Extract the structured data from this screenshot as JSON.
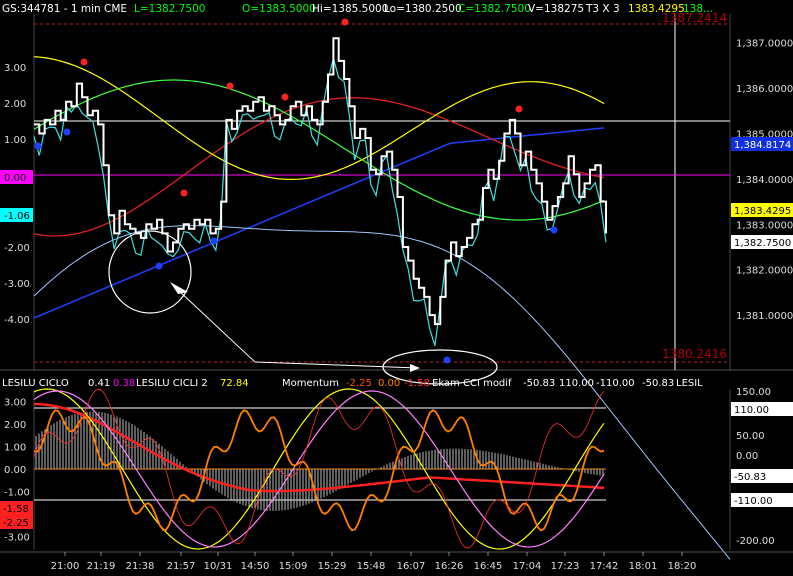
{
  "header": {
    "symbol": "GS:344781 - 1 min",
    "exchange": "CME",
    "last": "L=1382.7500",
    "open": "O=1383.5000",
    "high": "Hi=1385.5000",
    "low": "Lo=1380.2500",
    "close": "C=1382.7500",
    "volume": "V=138275",
    "timeframe": "T3 X 3",
    "val1": "1383.4295",
    "val2": "138..."
  },
  "price_panel": {
    "top_level_label": "1387.2414",
    "bottom_level_label": "1380.2416",
    "right_ticks": [
      "1,387.0000",
      "1,386.0000",
      "1,385.0000",
      "1,384.0000",
      "1,383.0000",
      "1,382.0000",
      "1,381.0000"
    ],
    "left_ticks": [
      "3.00",
      "2.00",
      "1.00",
      "0.00",
      "-1.00",
      "-2.00",
      "-3.00",
      "-4.00"
    ],
    "right_badges": [
      {
        "id": "blue",
        "text": "1,384.8174",
        "bg": "#1030e0",
        "fg": "#ffffff"
      },
      {
        "id": "yellow",
        "text": "1,383.4295",
        "bg": "#ffff00",
        "fg": "#000000"
      },
      {
        "id": "white",
        "text": "1,382.7500",
        "bg": "#ffffff",
        "fg": "#000000"
      }
    ],
    "left_badges": [
      {
        "id": "magenta",
        "text": "0.00",
        "bg": "#ff00ff",
        "fg": "#000000"
      },
      {
        "id": "cyan",
        "text": "-1.06",
        "bg": "#00ffff",
        "fg": "#000000"
      }
    ]
  },
  "osc_panel": {
    "legend": [
      {
        "text": "LESILU CICLO",
        "color": "#ffffff"
      },
      {
        "text": "0.41",
        "color": "#ffffff"
      },
      {
        "text": "0.38",
        "color": "#ff00ff"
      },
      {
        "text": "LESILU CICLI 2",
        "color": "#ffffff"
      },
      {
        "text": "72.84",
        "color": "#ffff00"
      },
      {
        "text": "Momentum",
        "color": "#ffffff"
      },
      {
        "text": "-2.25",
        "color": "#ff5000"
      },
      {
        "text": "0.00",
        "color": "#ff8000"
      },
      {
        "text": "-1.58",
        "color": "#ff3030"
      },
      {
        "text": "Ekam CCI modif",
        "color": "#ffffff"
      },
      {
        "text": "-50.83",
        "color": "#ffffff"
      },
      {
        "text": "110.00",
        "color": "#ffffff"
      },
      {
        "text": "-110.00",
        "color": "#ffffff"
      },
      {
        "text": "-50.83",
        "color": "#ffffff"
      },
      {
        "text": "LESIL",
        "color": "#ffffff"
      }
    ],
    "left_ticks": [
      "3.00",
      "2.00",
      "1.00",
      "0.00",
      "-1.00",
      "-2.00",
      "-3.00"
    ],
    "right_ticks": [
      "150.00",
      "50.00",
      "0.00",
      "-100.00",
      "-200.00"
    ],
    "right_badges": [
      {
        "id": "b110",
        "text": "110.00",
        "bg": "#ffffff",
        "fg": "#000000"
      },
      {
        "id": "b50",
        "text": "-50.83",
        "bg": "#ffffff",
        "fg": "#000000"
      },
      {
        "id": "bm110",
        "text": "-110.00",
        "bg": "#ffffff",
        "fg": "#000000"
      }
    ],
    "left_badges": [
      {
        "id": "r1",
        "text": "-1.58",
        "bg": "#ff2020",
        "fg": "#000000"
      },
      {
        "id": "r2",
        "text": "-2.25",
        "bg": "#ff2020",
        "fg": "#000000"
      }
    ]
  },
  "time_axis": [
    "21:00",
    "21:19",
    "21:38",
    "21:57",
    "10/31",
    "14:50",
    "15:09",
    "15:29",
    "15:48",
    "16:07",
    "16:26",
    "16:45",
    "17:04",
    "17:23",
    "17:42",
    "18:01",
    "18:20"
  ],
  "chart_data": {
    "type": "line",
    "price_range": [
      1379.9,
      1387.5
    ],
    "top_level": 1387.2414,
    "bottom_level": 1380.2416,
    "price": [
      1385.2,
      1385.0,
      1385.3,
      1385.2,
      1385.5,
      1385.3,
      1385.7,
      1385.6,
      1386.1,
      1385.8,
      1385.4,
      1385.5,
      1385.2,
      1384.3,
      1383.2,
      1382.8,
      1383.3,
      1383.0,
      1382.9,
      1382.8,
      1382.7,
      1383.0,
      1382.9,
      1383.1,
      1382.8,
      1382.4,
      1382.6,
      1382.9,
      1383.0,
      1382.9,
      1383.1,
      1383.0,
      1383.1,
      1382.8,
      1382.9,
      1383.5,
      1385.3,
      1385.1,
      1385.5,
      1385.6,
      1385.5,
      1385.7,
      1385.8,
      1385.5,
      1385.6,
      1385.4,
      1385.2,
      1385.3,
      1385.6,
      1385.7,
      1385.4,
      1385.6,
      1385.3,
      1385.2,
      1385.7,
      1386.3,
      1387.1,
      1386.6,
      1386.2,
      1385.6,
      1384.9,
      1385.1,
      1384.9,
      1384.2,
      1384.1,
      1384.5,
      1384.6,
      1384.2,
      1383.6,
      1382.5,
      1382.2,
      1381.8,
      1381.6,
      1381.4,
      1381.0,
      1380.8,
      1381.4,
      1382.2,
      1382.6,
      1382.3,
      1382.5,
      1382.7,
      1383.0,
      1383.1,
      1383.8,
      1384.2,
      1384.0,
      1384.4,
      1385.0,
      1385.3,
      1385.0,
      1384.3,
      1384.6,
      1384.2,
      1383.9,
      1383.5,
      1383.1,
      1383.4,
      1383.6,
      1383.9,
      1384.5,
      1384.1,
      1383.6,
      1383.9,
      1384.2,
      1384.3,
      1383.5,
      1382.8
    ]
  }
}
